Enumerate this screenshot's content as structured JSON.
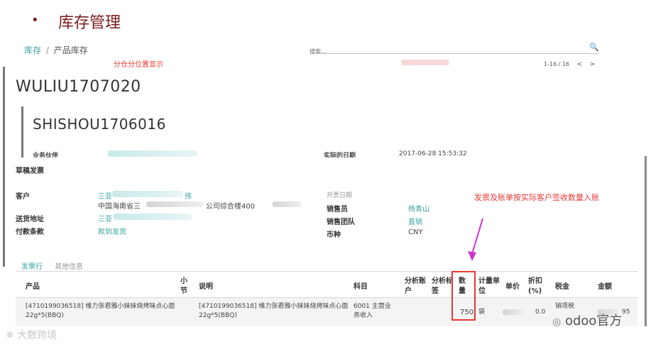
{
  "slide": {
    "bullet": "•",
    "title": "库存管理"
  },
  "breadcrumb": {
    "parent": "库存",
    "separator": "/",
    "current": "产品库存"
  },
  "search": {
    "placeholder": "搜索..."
  },
  "annotations": {
    "warehouse_note": "分仓分位置显示",
    "invoice_note": "发票及账单按实际客户签收数量入账"
  },
  "pager": {
    "range": "1-16 / 16",
    "prev": "<",
    "next": ">"
  },
  "records": {
    "ref_1": "WULIU1707020",
    "ref_2": "SHISHOU1706016",
    "strip": {
      "partner_label": "业务伙伴",
      "date_label": "实际的日期",
      "date_value": "2017-06-28 15:53:32"
    }
  },
  "invoice": {
    "status": "草稿发票",
    "customer_label": "客户",
    "customer_value": "三亚",
    "customer_suffix": "伟",
    "customer_addr": "中国海南省三",
    "customer_addr_2": "公司综合楼400",
    "delivery_label": "送货地址",
    "delivery_value": "三亚",
    "payment_label": "付款条款",
    "payment_value": "款到发货",
    "invoice_date_label": "开票日期",
    "salesperson_label": "销售员",
    "salesperson_value": "杨青山",
    "sales_team_label": "销售团队",
    "sales_team_value": "直销",
    "currency_label": "币种",
    "currency_value": "CNY"
  },
  "tabs": [
    {
      "label": "发票行"
    },
    {
      "label": "其他信息"
    }
  ],
  "table": {
    "headers": {
      "product": "产品",
      "section": "小节",
      "description": "说明",
      "account": "科目",
      "analytic_account": "分析账户",
      "analytic_tags": "分析标签",
      "quantity": "数量",
      "uom": "计量单位",
      "unit_price": "单价",
      "discount": "折扣(%)",
      "taxes": "税金",
      "amount": "金额"
    },
    "rows": [
      {
        "product": "[4710199036518] 维力张君雅小妹妹烧烤味点心面22g*5(BBQ)",
        "description": "[4710199036518] 维力张君雅小妹妹烧烤味点心面22g*5(BBQ)",
        "account": "6001 主营业务收入",
        "quantity": "750",
        "uom": "袋",
        "discount": "0.0",
        "taxes": "销项税",
        "amount": "95"
      }
    ]
  },
  "watermarks": {
    "left": "大数跨境",
    "right": "odoo官方"
  },
  "colors": {
    "accent": "#3aa3a3",
    "highlight": "#e53935",
    "title": "#7a1c1c",
    "arrow": "#cc33cc"
  }
}
